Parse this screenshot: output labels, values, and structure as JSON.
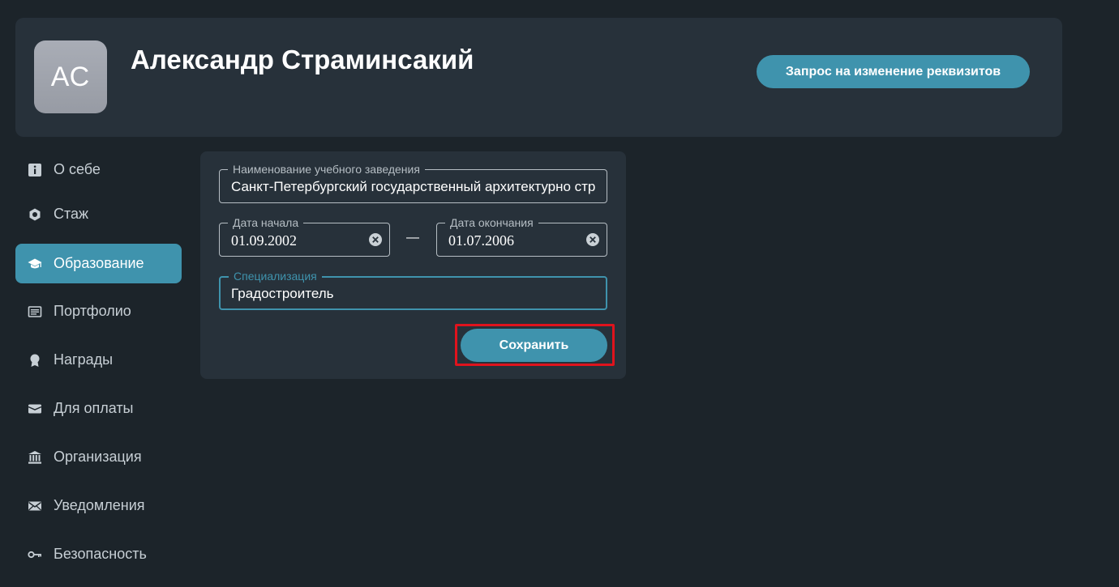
{
  "profile": {
    "initials": "АС",
    "name": "Александр Страминсакий",
    "request_button": "Запрос на изменение реквизитов"
  },
  "sidebar": {
    "items": [
      {
        "label": "О себе",
        "icon": "info-icon"
      },
      {
        "label": "Стаж",
        "icon": "hexagon-icon"
      },
      {
        "label": "Образование",
        "icon": "graduation-cap-icon",
        "active": true
      },
      {
        "label": "Портфолио",
        "icon": "document-icon"
      },
      {
        "label": "Награды",
        "icon": "award-icon"
      },
      {
        "label": "Для оплаты",
        "icon": "wallet-icon"
      },
      {
        "label": "Организация",
        "icon": "bank-icon"
      },
      {
        "label": "Уведомления",
        "icon": "envelope-icon"
      },
      {
        "label": "Безопасность",
        "icon": "key-icon"
      }
    ]
  },
  "education_form": {
    "institution": {
      "label": "Наименование учебного заведения",
      "value": "Санкт-Петербургский государственный архитектурно строительный университет"
    },
    "start_date": {
      "label": "Дата начала",
      "value": "01.09.2002"
    },
    "separator": "—",
    "end_date": {
      "label": "Дата окончания",
      "value": "01.07.2006"
    },
    "specialization": {
      "label": "Специализация",
      "value": "Градостроитель"
    },
    "save_button": "Сохранить"
  },
  "colors": {
    "background": "#1c242a",
    "card": "#27313a",
    "accent": "#3f93ad",
    "highlight": "#e0131d"
  }
}
